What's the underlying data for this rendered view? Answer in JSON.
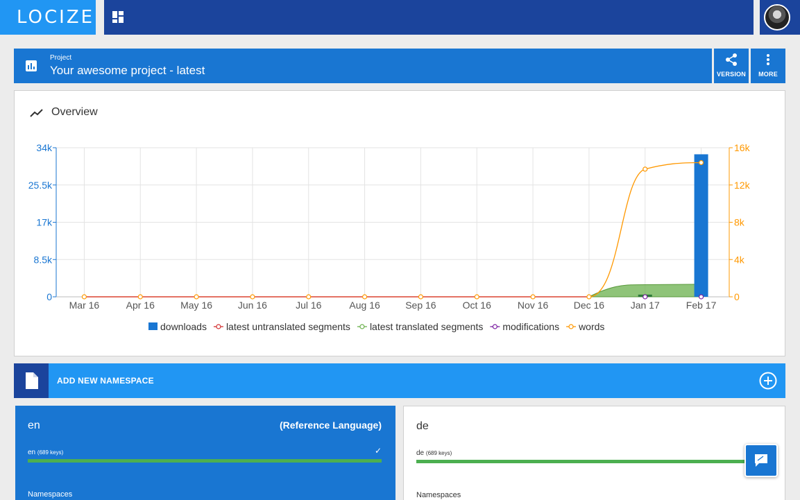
{
  "app": {
    "logo_text": "LOCIZE",
    "brand_color": "#2196f3",
    "nav_color": "#1b449c"
  },
  "project": {
    "subtitle": "Project",
    "title": "Your awesome project - latest",
    "version_label": "VERSION",
    "more_label": "MORE"
  },
  "overview": {
    "title": "Overview"
  },
  "chart_data": {
    "type": "bar+line",
    "categories": [
      "Mar 16",
      "Apr 16",
      "May 16",
      "Jun 16",
      "Jul 16",
      "Aug 16",
      "Sep 16",
      "Oct 16",
      "Nov 16",
      "Dec 16",
      "Jan 17",
      "Feb 17"
    ],
    "left_axis": {
      "ticks": [
        "0",
        "8.5k",
        "17k",
        "25.5k",
        "34k"
      ],
      "max": 34000,
      "color": "#1976d2"
    },
    "right_axis": {
      "ticks": [
        "0",
        "4k",
        "8k",
        "12k",
        "16k"
      ],
      "max": 16000,
      "color": "#ff9800"
    },
    "series": [
      {
        "name": "downloads",
        "kind": "bar",
        "axis": "left",
        "color": "#1976d2",
        "values": [
          0,
          0,
          0,
          0,
          0,
          0,
          0,
          0,
          0,
          0,
          0,
          32500
        ]
      },
      {
        "name": "latest untranslated segments",
        "kind": "line",
        "axis": "right",
        "color": "#d32f2f",
        "values": [
          0,
          0,
          0,
          0,
          0,
          0,
          0,
          0,
          0,
          0,
          0,
          0
        ]
      },
      {
        "name": "latest translated segments",
        "kind": "area",
        "axis": "right",
        "color": "#6ab04c",
        "values": [
          0,
          0,
          0,
          0,
          0,
          0,
          0,
          0,
          0,
          0,
          1300,
          1350
        ]
      },
      {
        "name": "modifications",
        "kind": "line",
        "axis": "right",
        "color": "#7b1fa2",
        "values": [
          0,
          0,
          0,
          0,
          0,
          0,
          0,
          0,
          0,
          0,
          0,
          0
        ]
      },
      {
        "name": "words",
        "kind": "line",
        "axis": "right",
        "color": "#ff9800",
        "values": [
          0,
          0,
          0,
          0,
          0,
          0,
          0,
          0,
          0,
          0,
          13700,
          14400
        ]
      }
    ],
    "jan_bar_value": 500,
    "grid": true,
    "legend_position": "bottom"
  },
  "namespace_bar": {
    "label": "ADD NEW NAMESPACE"
  },
  "languages": [
    {
      "code": "en",
      "ref_label": "(Reference Language)",
      "keys_lang": "en",
      "keys_count": "(689 keys)",
      "check": "✓",
      "progress": 1.0,
      "namespaces_label": "Namespaces"
    },
    {
      "code": "de",
      "keys_lang": "de",
      "keys_count": "(689 keys)",
      "progress": 1.0,
      "namespaces_label": "Namespaces"
    }
  ]
}
